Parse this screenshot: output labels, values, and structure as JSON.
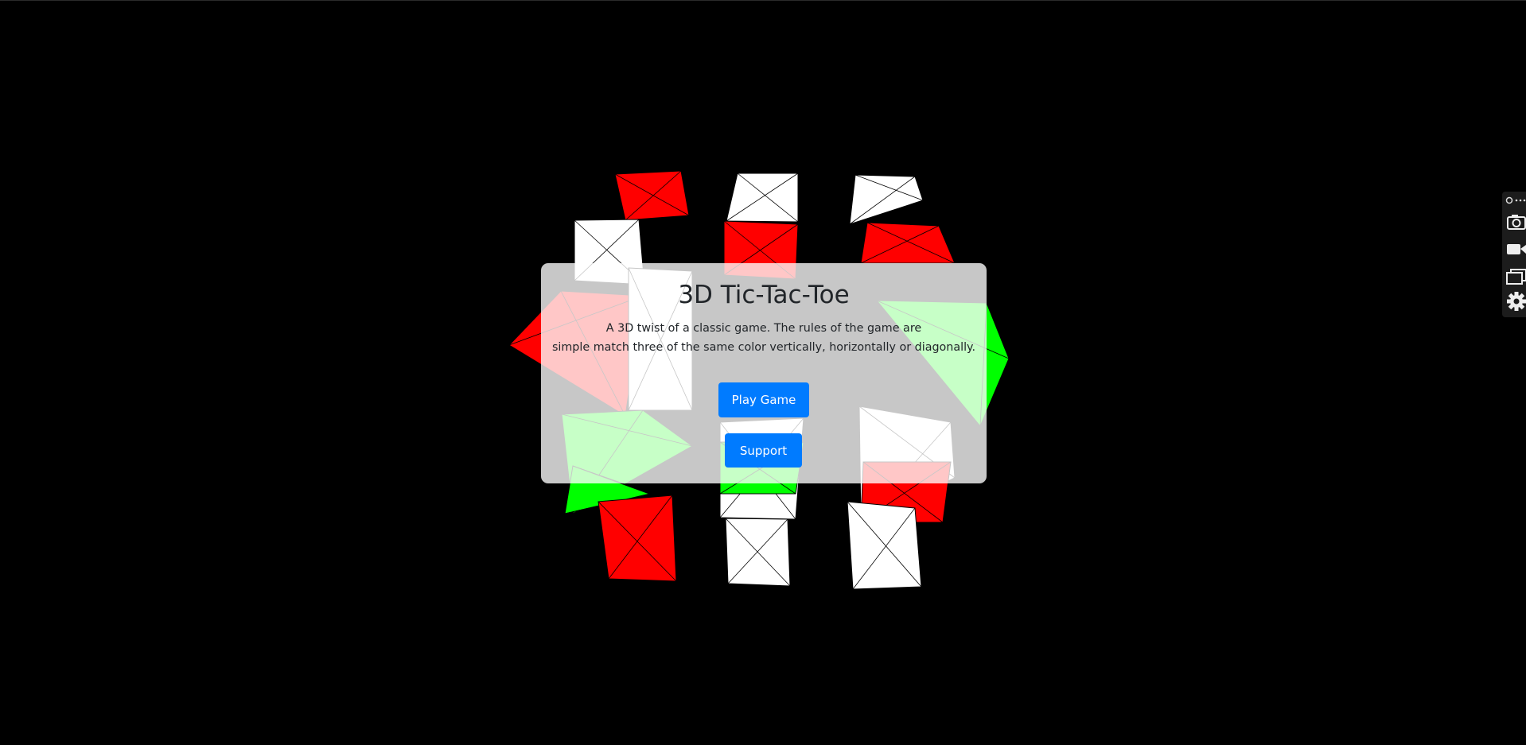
{
  "page": {
    "title": "3D Tic-Tac-Toe",
    "description_line1": "A 3D twist of a classic game. The rules of the game are",
    "description_line2": "simple match three of the same color vertically, horizontally or diagonally."
  },
  "buttons": {
    "play_label": "Play Game",
    "support_label": "Support"
  },
  "toolbar": {
    "tools": [
      "pin-more-icon",
      "camera-icon",
      "video-camera-icon",
      "window-icon",
      "gear-icon"
    ]
  },
  "colors": {
    "background": "#000000",
    "red_piece": "#ff0000",
    "green_piece": "#00ff00",
    "empty_cell": "#ffffff",
    "button": "#007bff"
  },
  "board": {
    "cells": [
      "red",
      "white",
      "white",
      "white",
      "red",
      "red",
      "red",
      "white",
      "green",
      "green",
      "white",
      "white",
      "green",
      "green",
      "red",
      "red",
      "white",
      "white"
    ]
  }
}
